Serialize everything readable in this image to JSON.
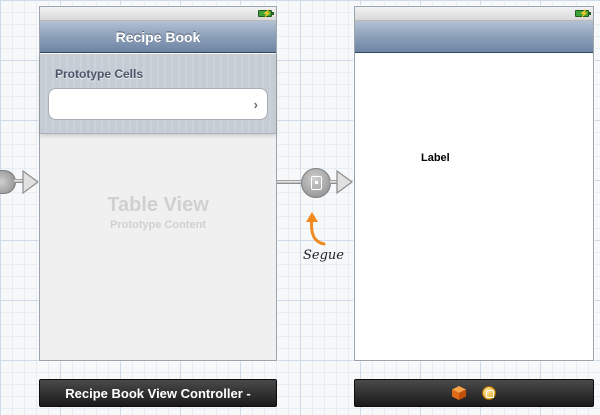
{
  "left_scene": {
    "nav_title": "Recipe Book",
    "section_header": "Prototype Cells",
    "cell_accessory": "›",
    "placeholder_title": "Table View",
    "placeholder_subtitle": "Prototype Content"
  },
  "right_scene": {
    "content_label": "Label"
  },
  "segue": {
    "caption": "Segue"
  },
  "docks": {
    "left_label": "Recipe Book View Controller -",
    "right_icons": [
      "view-controller-cube-icon",
      "exit-icon"
    ]
  },
  "colors": {
    "nav_bar_top": "#b3c1d3",
    "nav_bar_bottom": "#6e85a3",
    "battery_green": "#3fa13a",
    "annotation_orange": "#f08a1c",
    "dock_dark": "#1a1a1a"
  }
}
